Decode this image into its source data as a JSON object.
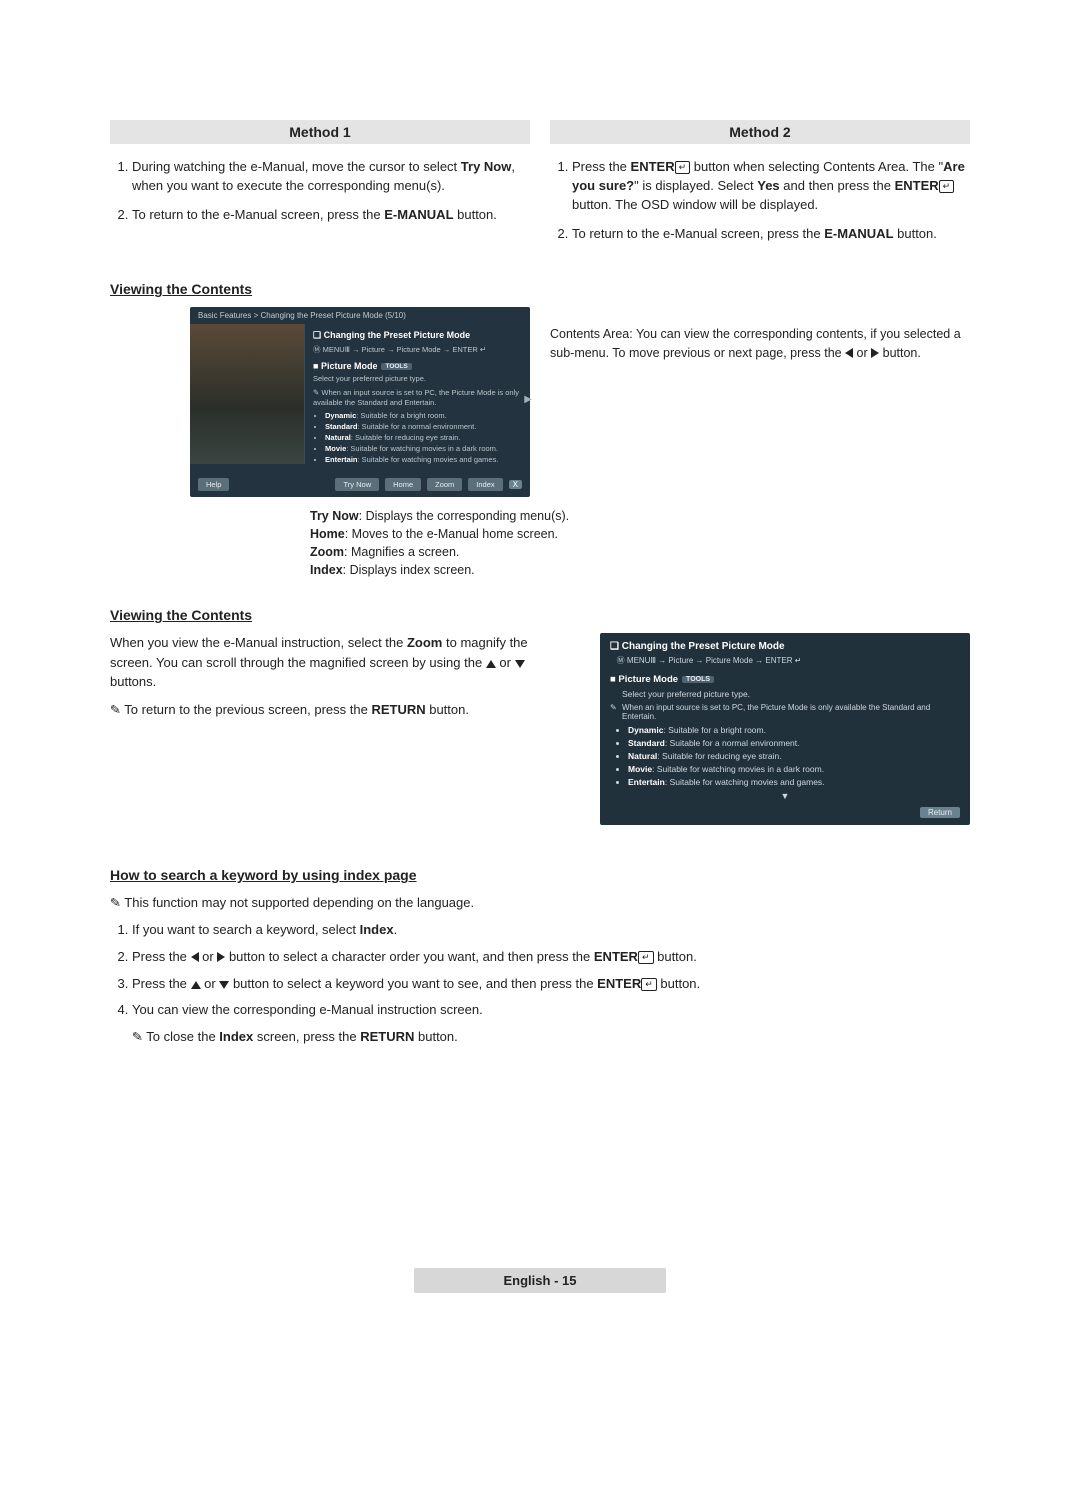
{
  "methods": {
    "col1_header": "Method 1",
    "col2_header": "Method 2",
    "m1_step1_a": "During watching the e-Manual, move the cursor to select ",
    "m1_step1_b": "Try Now",
    "m1_step1_c": ", when you want to execute the corresponding menu(s).",
    "m1_step2_a": "To return to the e-Manual screen, press the ",
    "m1_step2_b": "E-MANUAL",
    "m1_step2_c": " button.",
    "m2_step1_a": "Press the ",
    "m2_step1_b": "ENTER",
    "m2_step1_c": " button when selecting Contents Area. The \"",
    "m2_step1_d": "Are you sure?",
    "m2_step1_e": "\" is displayed. Select ",
    "m2_step1_f": "Yes",
    "m2_step1_g": " and then press the ",
    "m2_step1_h": "ENTER",
    "m2_step1_i": " button. The OSD window will be displayed.",
    "m2_step2_a": "To return to the e-Manual screen, press the ",
    "m2_step2_b": "E-MANUAL",
    "m2_step2_c": " button."
  },
  "viewing_heading": "Viewing the Contents",
  "osd": {
    "breadcrumb": "Basic Features > Changing the Preset Picture Mode (5/10)",
    "panel_title": "Changing the Preset Picture Mode",
    "menuline_a": "MENU",
    "menuline_b": " → Picture → Picture Mode → ENTER",
    "sub": "Picture Mode",
    "badge": "TOOLS",
    "select_text": "Select your preferred picture type.",
    "note_text": "When an input source is set to PC, the Picture Mode is only available the Standard and Entertain.",
    "items": [
      {
        "b": "Dynamic",
        "t": ": Suitable for a bright room."
      },
      {
        "b": "Standard",
        "t": ": Suitable for a normal environment."
      },
      {
        "b": "Natural",
        "t": ": Suitable for reducing eye strain."
      },
      {
        "b": "Movie",
        "t": ": Suitable for watching movies in a dark room."
      },
      {
        "b": "Entertain",
        "t": ": Suitable for watching movies and games."
      }
    ],
    "help": "Help",
    "trynow": "Try Now",
    "home": "Home",
    "zoom": "Zoom",
    "index": "Index",
    "close": "X"
  },
  "callout": {
    "line1": "Contents Area: You can view the corresponding contents, if you selected a sub-menu. To move previous or next page, press the ",
    "line2": " or ",
    "line3": " button."
  },
  "legend": {
    "l1a": "Try Now",
    "l1b": ": Displays the corresponding menu(s).",
    "l2a": "Home",
    "l2b": ": Moves to the e-Manual home screen.",
    "l3a": "Zoom",
    "l3b": ": Magnifies a screen.",
    "l4a": "Index",
    "l4b": ": Displays index screen."
  },
  "viewing2": {
    "heading": "Viewing the Contents",
    "p1a": "When you view the e-Manual instruction, select the ",
    "p1b": "Zoom",
    "p1c": " to magnify the screen. You can scroll through the magnified screen by using the ",
    "p1d": " or ",
    "p1e": " buttons.",
    "note_a": "To return to the previous screen, press the ",
    "note_b": "RETURN",
    "note_c": " button."
  },
  "zoombox": {
    "title": "Changing the Preset Picture Mode",
    "menuline_a": "MENU",
    "menuline_b": " → Picture → Picture Mode → ENTER",
    "sub": "Picture Mode",
    "badge": "TOOLS",
    "select_text": "Select your preferred picture type.",
    "note_text": "When an input source is set to PC, the Picture Mode is only available the Standard and Entertain.",
    "items": [
      {
        "b": "Dynamic",
        "t": ": Suitable for a bright room."
      },
      {
        "b": "Standard",
        "t": ": Suitable for a normal environment."
      },
      {
        "b": "Natural",
        "t": ": Suitable for reducing eye strain."
      },
      {
        "b": "Movie",
        "t": ": Suitable for watching movies in a dark room."
      },
      {
        "b": "Entertain",
        "t": ": Suitable for watching movies and games."
      }
    ],
    "return": "Return"
  },
  "search": {
    "heading": "How to search a keyword by using index page",
    "note": "This function may not supported depending on the language.",
    "s1a": "If you want to search a keyword, select ",
    "s1b": "Index",
    "s1c": ".",
    "s2a": "Press the ",
    "s2b": " or ",
    "s2c": " button to select a character order you want, and then press the ",
    "s2d": "ENTER",
    "s2e": " button.",
    "s3a": "Press the ",
    "s3b": " or ",
    "s3c": " button to select a keyword you want to see, and then press the ",
    "s3d": "ENTER",
    "s3e": " button.",
    "s4": "You can view the corresponding e-Manual instruction screen.",
    "close_a": "To close the ",
    "close_b": "Index",
    "close_c": " screen, press the ",
    "close_d": "RETURN",
    "close_e": " button."
  },
  "footer": {
    "lang": "English",
    "sep": " - ",
    "page": "15"
  },
  "glyph": {
    "note": "✎",
    "enter": "↵",
    "square": "❏",
    "filled_square": "■",
    "menu_icon": "Ⅲ"
  }
}
